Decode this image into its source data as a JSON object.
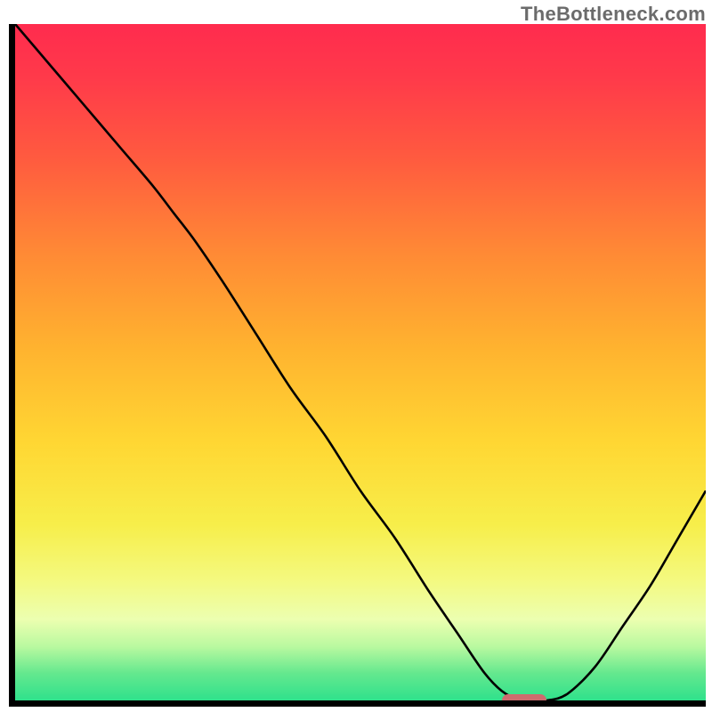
{
  "watermark": "TheBottleneck.com",
  "marker": {
    "left_pct": 70.5,
    "width_pct": 6.4,
    "color": "#ce6b6e"
  },
  "chart_data": {
    "type": "line",
    "title": "",
    "xlabel": "",
    "ylabel": "",
    "xlim": [
      0,
      100
    ],
    "ylim": [
      0,
      100
    ],
    "grid": false,
    "legend": false,
    "series": [
      {
        "name": "bottleneck-curve",
        "color": "#000000",
        "x": [
          0,
          5,
          10,
          15,
          20,
          23,
          26,
          30,
          35,
          40,
          45,
          50,
          55,
          60,
          64,
          68,
          71,
          74,
          77,
          80,
          84,
          88,
          92,
          96,
          100
        ],
        "y": [
          100,
          94,
          88,
          82,
          76,
          72,
          68,
          62,
          54,
          46,
          39,
          31,
          24,
          16,
          10,
          4,
          1,
          0,
          0,
          1,
          5,
          11,
          17,
          24,
          31
        ]
      }
    ],
    "background_gradient": {
      "type": "vertical",
      "stops": [
        {
          "pos": 0.0,
          "color": "#ff2b4e"
        },
        {
          "pos": 0.2,
          "color": "#ff5b3f"
        },
        {
          "pos": 0.48,
          "color": "#ffb32f"
        },
        {
          "pos": 0.74,
          "color": "#f7ee4a"
        },
        {
          "pos": 0.92,
          "color": "#baf9a0"
        },
        {
          "pos": 1.0,
          "color": "#2fe18c"
        }
      ]
    },
    "annotations": [
      {
        "type": "pill-marker",
        "x_center": 73.7,
        "y": 0,
        "color": "#ce6b6e"
      }
    ]
  }
}
